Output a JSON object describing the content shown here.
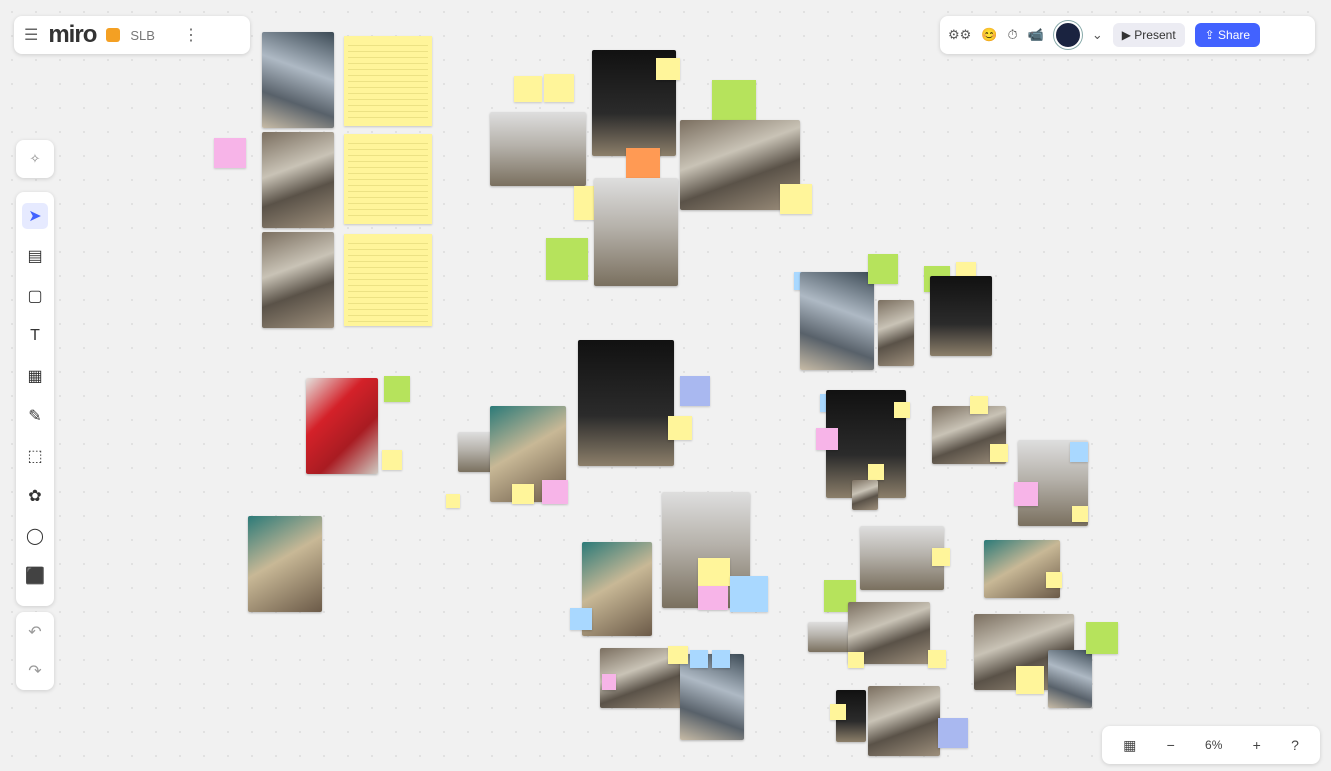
{
  "app": {
    "logo": "miro",
    "board_title": "SLB",
    "more_menu": "⋮"
  },
  "top_right": {
    "reactions_label": "😊",
    "timer_label": "⏱",
    "video_label": "📹",
    "avatar_chevron": "⌄",
    "present_label": "▶ Present",
    "share_label": "⇪ Share"
  },
  "toolbar": {
    "items": [
      {
        "name": "select",
        "icon": "cursor-icon",
        "glyph": "➤"
      },
      {
        "name": "templates",
        "icon": "templates-icon",
        "glyph": "▤"
      },
      {
        "name": "sticky-note",
        "icon": "sticky-note-icon",
        "glyph": "▢"
      },
      {
        "name": "text",
        "icon": "text-icon",
        "glyph": "T"
      },
      {
        "name": "shapes",
        "icon": "shapes-icon",
        "glyph": "▦"
      },
      {
        "name": "pen",
        "icon": "pen-icon",
        "glyph": "✎"
      },
      {
        "name": "frame",
        "icon": "frame-icon",
        "glyph": "⬚"
      },
      {
        "name": "apps",
        "icon": "apps-icon",
        "glyph": "✿"
      },
      {
        "name": "comment",
        "icon": "comment-icon",
        "glyph": "◯"
      },
      {
        "name": "upload",
        "icon": "upload-icon",
        "glyph": "⬛"
      }
    ],
    "undo_glyph": "↶",
    "redo_glyph": "↷"
  },
  "bottom_right": {
    "map_glyph": "▦",
    "zoom_out_glyph": "−",
    "zoom_level": "6%",
    "zoom_in_glyph": "+",
    "help_glyph": "?"
  },
  "colors": {
    "accent": "#4262ff",
    "sticky_yellow": "#fff59a",
    "sticky_green": "#b6e35c",
    "sticky_pink": "#f7b4e8",
    "sticky_blue": "#a9d8ff"
  }
}
